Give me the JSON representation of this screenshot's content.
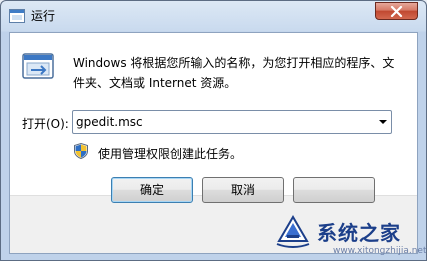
{
  "window": {
    "title": "运行",
    "close_icon": "close-icon"
  },
  "main": {
    "description": "Windows 将根据您所输入的名称，为您打开相应的程序、文件夹、文档或 Internet 资源。",
    "open_label": "打开(O):",
    "open_value": "gpedit.msc",
    "admin_note": "使用管理权限创建此任务。"
  },
  "buttons": {
    "ok": "确定",
    "cancel": "取消"
  },
  "watermark": {
    "text": "系统之家",
    "url": "www.xitongzhijia.net"
  },
  "colors": {
    "close_red": "#c04830",
    "watermark_blue": "#1c3f8a"
  }
}
